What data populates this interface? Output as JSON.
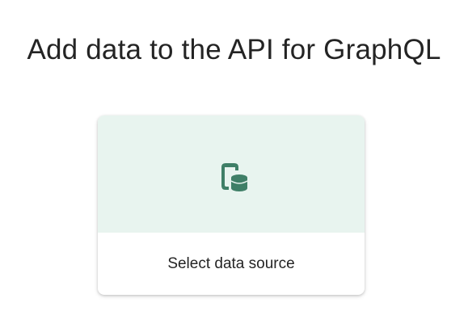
{
  "page": {
    "title": "Add data to the API for GraphQL"
  },
  "card": {
    "label": "Select data source",
    "icon": "database-source-icon",
    "hero_background": "#e8f4ef",
    "icon_color": "#3f7f67"
  }
}
